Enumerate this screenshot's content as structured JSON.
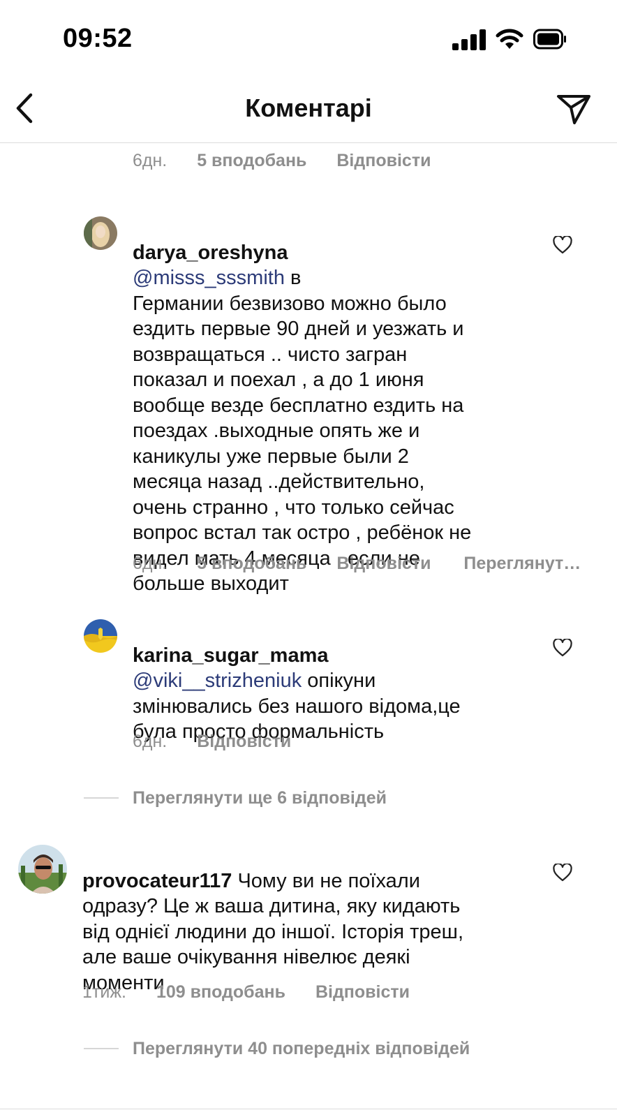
{
  "status_bar": {
    "time": "09:52"
  },
  "header": {
    "title": "Коментарі"
  },
  "comments": [
    {
      "meta": {
        "age": "6дн.",
        "likes": "5 вподобань",
        "reply": "Відповісти"
      }
    },
    {
      "username": "darya_oreshyna",
      "mention": "@misss_sssmith",
      "text_first": " в",
      "text_rest": "Германии безвизово можно было\nездить первые 90 дней и уезжать и\nвозвращаться .. чисто загран\nпоказал и поехал , а до 1 июня\nвообще везде бесплатно ездить на\nпоездах .выходные опять же и\nканикулы уже первые были 2\nмесяца назад ..действительно,\nочень странно , что только сейчас\nвопрос встал так остро , ребёнок не\nвидел мать 4 месяца , если не\nбольше выходит",
      "meta": {
        "age": "6дн.",
        "likes": "5 вподобань",
        "reply": "Відповісти",
        "translate": "Переглянути переклад"
      }
    },
    {
      "username": "karina_sugar_mama",
      "mention": "@viki__strizheniuk",
      "text_first": " опікуни",
      "text_rest": "змінювались без нашого відома,це\nбула просто формальність",
      "meta": {
        "age": "6дн.",
        "reply": "Відповісти"
      }
    },
    {
      "username": "provocateur117",
      "text_first": " Чому ви не поїхали",
      "text_rest": "одразу? Це ж ваша дитина, яку кидають\nвід однієї людини до іншої. Історія треш,\nале ваше очікування нівелює деякі\nмоменти",
      "meta": {
        "age": "1тиж.",
        "likes": "109 вподобань",
        "reply": "Відповісти"
      }
    }
  ],
  "view_replies_1": "Переглянути ще 6 відповідей",
  "view_replies_2": "Переглянути 40 попередніх відповідей",
  "icons": {
    "back": "chevron-left-icon",
    "send": "paper-plane-icon",
    "like": "heart-outline-icon"
  }
}
